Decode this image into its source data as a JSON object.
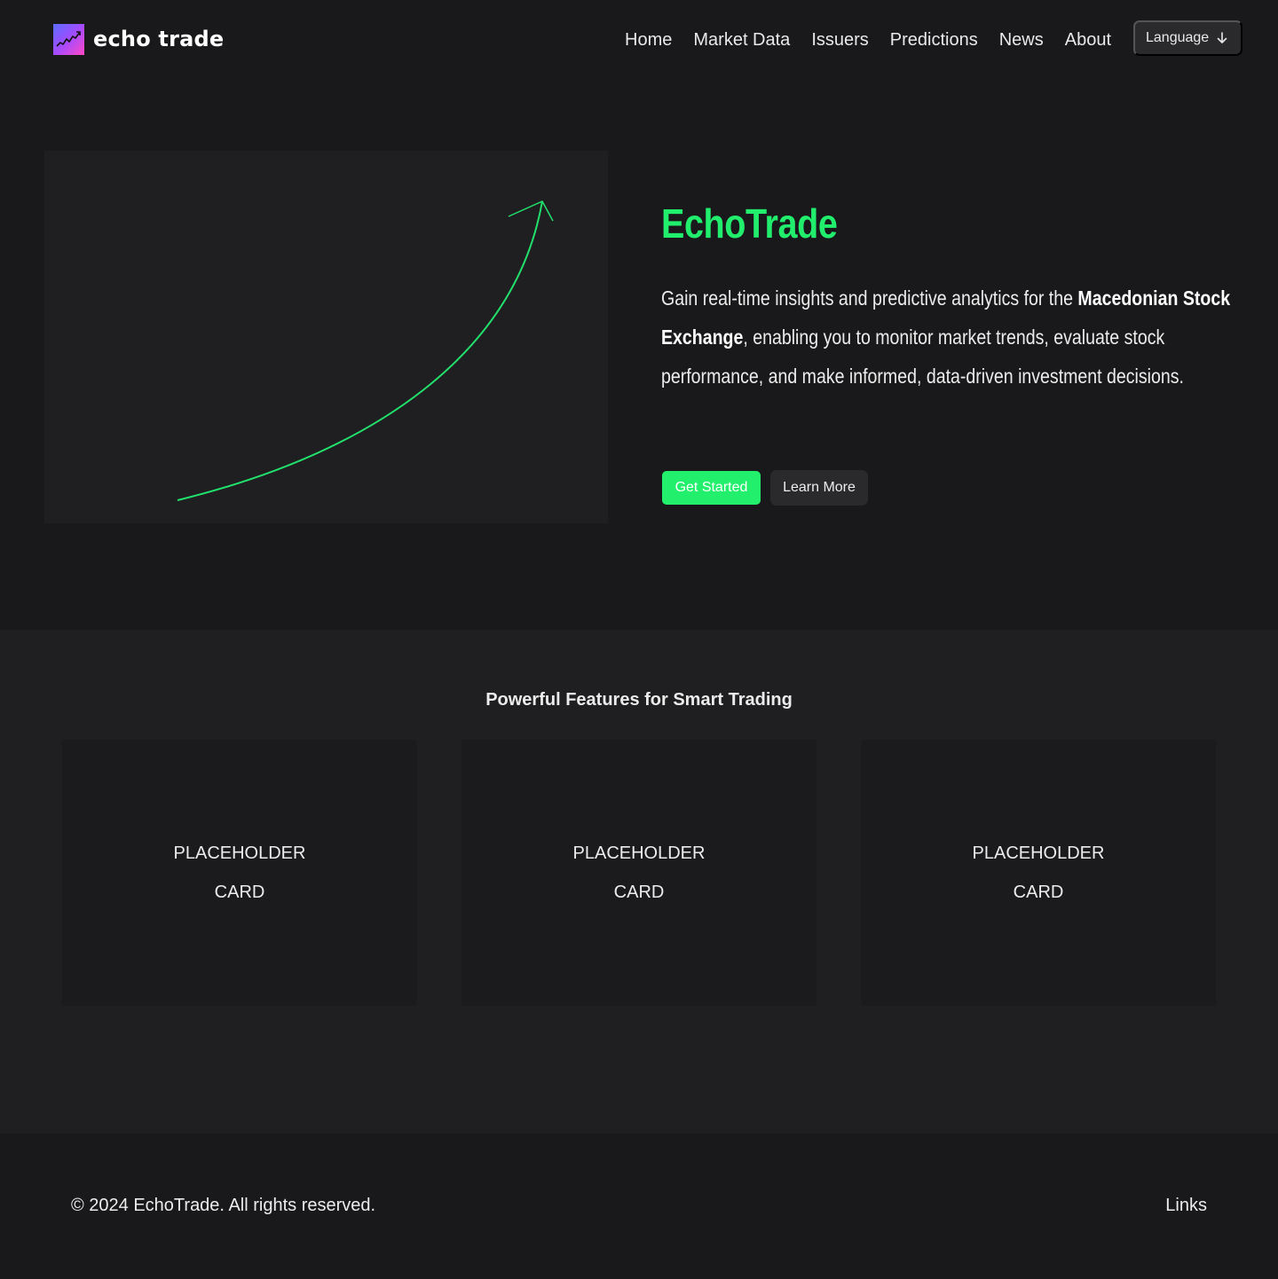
{
  "brand": {
    "name": "echo trade",
    "logo_icon": "trending-chart-icon",
    "logo_gradient": [
      "#5b6cff",
      "#a34bff",
      "#ff48c4"
    ]
  },
  "nav": {
    "items": [
      {
        "label": "Home"
      },
      {
        "label": "Market Data"
      },
      {
        "label": "Issuers"
      },
      {
        "label": "Predictions"
      },
      {
        "label": "News"
      },
      {
        "label": "About"
      }
    ],
    "language_label": "Language",
    "language_icon": "arrow-down-icon"
  },
  "hero": {
    "title": "EchoTrade",
    "description_parts": {
      "before": "Gain real-time insights and predictive analytics for the ",
      "bold": "Macedonian Stock Exchange",
      "after": ", enabling you to monitor market trends, evaluate stock performance, and make informed, data-driven investment decisions."
    },
    "primary_button": "Get Started",
    "secondary_button": "Learn More",
    "visual_icon": "growth-arrow-icon"
  },
  "features": {
    "title": "Powerful Features for Smart Trading",
    "cards": [
      {
        "label": "PLACEHOLDER CARD"
      },
      {
        "label": "PLACEHOLDER CARD"
      },
      {
        "label": "PLACEHOLDER CARD"
      }
    ]
  },
  "footer": {
    "copyright": "© 2024 EchoTrade. All rights reserved.",
    "links_label": "Links"
  },
  "colors": {
    "background": "#19191b",
    "section_background": "#1f1f21",
    "accent": "#22f06c",
    "button_secondary": "#2a2a2d"
  }
}
